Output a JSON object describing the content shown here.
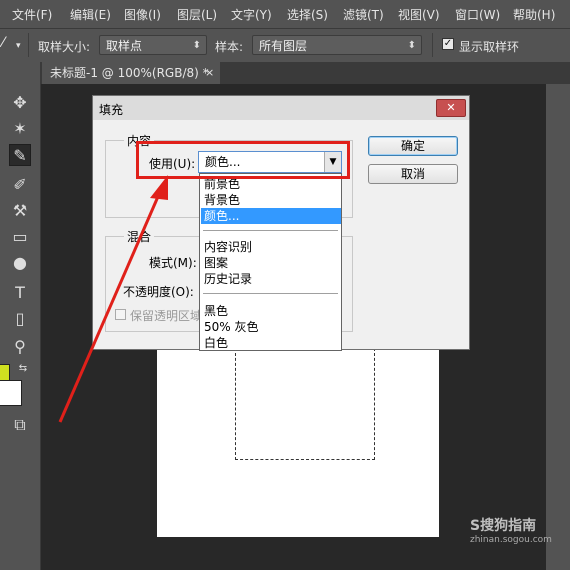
{
  "menubar": {
    "items": [
      "文件(F)",
      "编辑(E)",
      "图像(I)",
      "图层(L)",
      "文字(Y)",
      "选择(S)",
      "滤镜(T)",
      "视图(V)",
      "窗口(W)",
      "帮助(H)"
    ]
  },
  "options": {
    "sample_size_label": "取样大小:",
    "sample_size_value": "取样点",
    "sample_label": "样本:",
    "sample_value": "所有图层",
    "show_ring_label": "显示取样环",
    "show_ring_checked": true
  },
  "document_tab": {
    "title": "未标题-1 @ 100%(RGB/8) *",
    "close": "×"
  },
  "colors": {
    "foreground": "#cfe020",
    "background": "#ffffff",
    "highlight": "#e0201a"
  },
  "dialog": {
    "title": "填充",
    "close": "✕",
    "contents_group": "内容",
    "use_label": "使用(U):",
    "use_value": "颜色...",
    "blending_group": "混合",
    "mode_label": "模式(M):",
    "opacity_label": "不透明度(O):",
    "preserve_label": "保留透明区域",
    "ok": "确定",
    "cancel": "取消"
  },
  "dropdown": {
    "items": [
      "前景色",
      "背景色",
      "颜色...",
      "内容识别",
      "图案",
      "历史记录",
      "黑色",
      "50% 灰色",
      "白色"
    ],
    "selected": "颜色..."
  },
  "watermark": {
    "main": "S搜狗指南",
    "url": "zhinan.sogou.com"
  }
}
